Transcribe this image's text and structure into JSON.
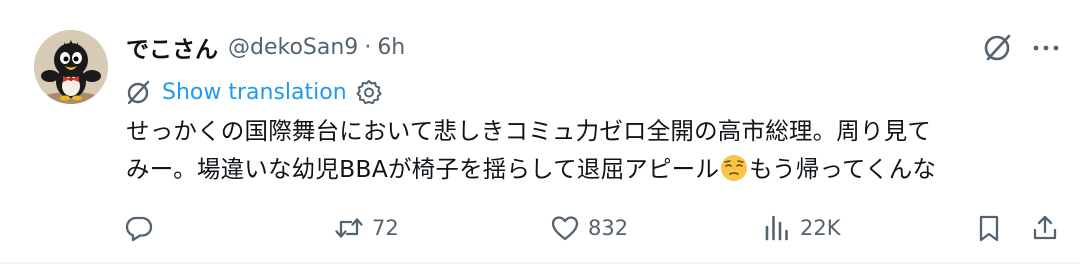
{
  "author": {
    "display_name": "でこさん",
    "handle": "@dekoSan9",
    "separator": "·",
    "time": "6h"
  },
  "translation": {
    "label": "Show translation"
  },
  "tweet": {
    "text_line1": "せっかくの国際舞台において悲しきコミュ力ゼロ全開の高市総理。周り見て",
    "text_line2_pre": "みー。場違いな幼児BBAが椅子を揺らして退屈アピール",
    "text_line2_post": "もう帰ってくんな"
  },
  "actions": {
    "retweets": "72",
    "likes": "832",
    "views": "22K"
  },
  "colors": {
    "text_primary": "#0f1419",
    "text_secondary": "#536471",
    "link_blue": "#1d9bf0",
    "divider": "#eff3f4"
  },
  "icons": {
    "grok": "grok-icon",
    "more": "more-icon",
    "language": "language-icon",
    "settings": "settings-icon",
    "reply": "reply-icon",
    "retweet": "retweet-icon",
    "like": "heart-icon",
    "views": "views-icon",
    "bookmark": "bookmark-icon",
    "share": "share-icon",
    "emoji": "pensive-face-emoji"
  }
}
